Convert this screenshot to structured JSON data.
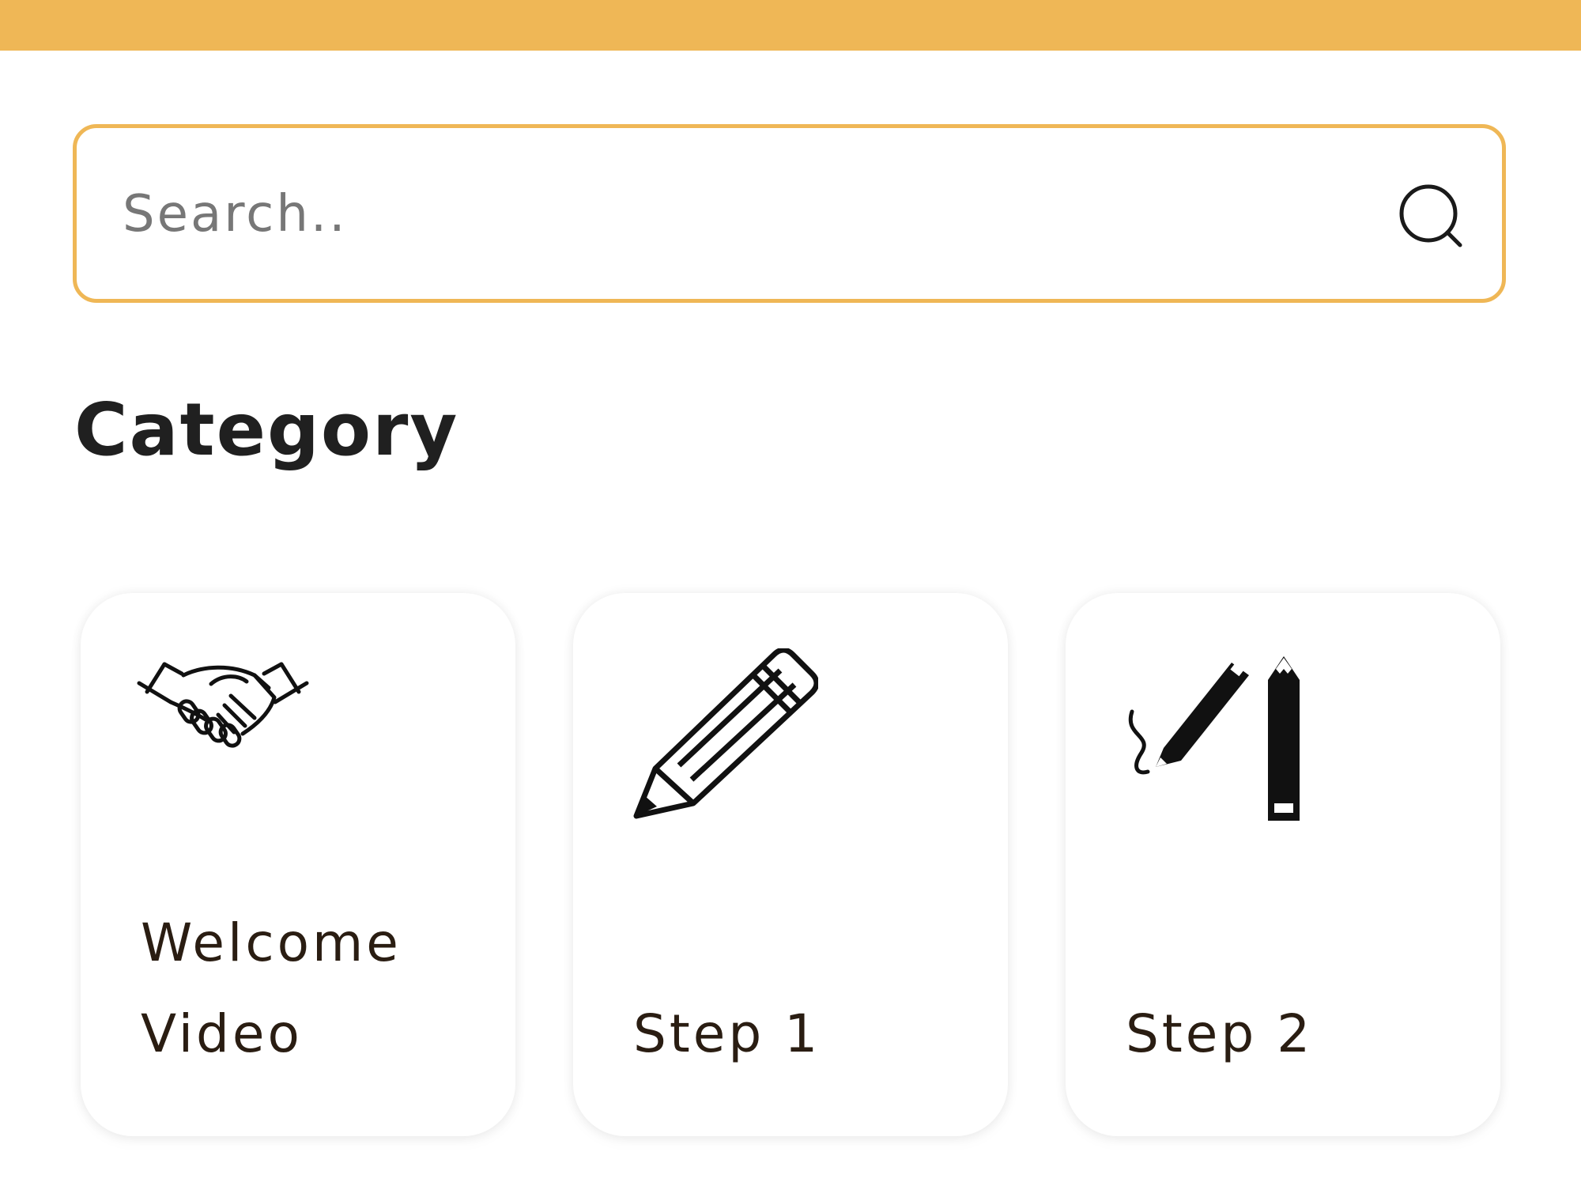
{
  "search": {
    "placeholder": "Search..",
    "icon": "search-icon"
  },
  "section": {
    "title": "Category"
  },
  "categories": [
    {
      "label": "Welcome Video",
      "icon": "handshake-icon"
    },
    {
      "label": "Step 1",
      "icon": "pencil-icon"
    },
    {
      "label": "Step 2",
      "icon": "pen-and-pencil-icon"
    }
  ],
  "colors": {
    "accent": "#EFB756",
    "text": "#202020",
    "card_text": "#2A1D12"
  }
}
